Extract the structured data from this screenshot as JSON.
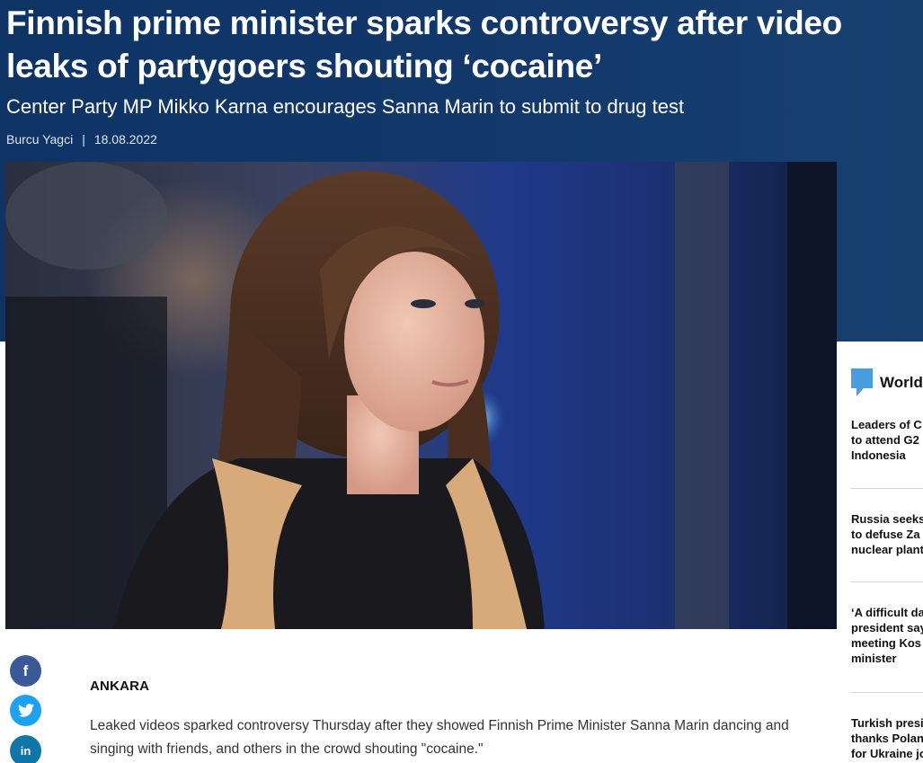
{
  "article": {
    "headline_line1": "Finnish prime minister sparks controversy after video",
    "headline_line2": "leaks of partygoers shouting ‘cocaine’",
    "subtitle": "Center Party MP Mikko Karna encourages Sanna Marin to submit to drug test",
    "author": "Burcu Yagci",
    "separator": "|",
    "date": "18.08.2022",
    "dateline": "ANKARA",
    "body": "Leaked videos sparked controversy Thursday after they showed Finnish Prime Minister Sanna Marin dancing and singing with friends, and others in the crowd shouting \"cocaine.\""
  },
  "share": {
    "facebook_icon": "f",
    "twitter_icon": "twitter-bird",
    "linkedin_icon": "in"
  },
  "sidebar": {
    "title": "World",
    "items": [
      {
        "text": "Leaders of C\nto attend G2\nIndonesia"
      },
      {
        "text": "Russia seeks\nto defuse Za\nnuclear plant"
      },
      {
        "text": "‘A difficult da\npresident say\nmeeting Kos\nminister"
      },
      {
        "text": "Turkish presi\nthanks Polan\nfor Ukraine jo"
      }
    ]
  },
  "colors": {
    "hero_bg": "#0e3466",
    "sidebar_accent": "#4a9ee0",
    "facebook": "#3b5998",
    "twitter": "#1da1f2",
    "linkedin": "#0e76a8"
  }
}
